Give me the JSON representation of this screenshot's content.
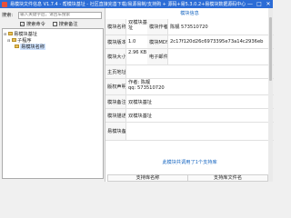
{
  "window": {
    "title": "易模块文件信息 V1.7.4 - 帮模块基址 - 社区直接完善下载/易源易制/支持购 + 源码+易5.3.0.2+易模块数据源码中心",
    "controls": [
      "—",
      "□",
      "✕"
    ]
  },
  "search": {
    "label": "搜索:",
    "placeholder": "输入关键字后，请回车搜索"
  },
  "filters": [
    {
      "label": "搜索命令",
      "checked": true
    },
    {
      "label": "搜索备注",
      "checked": false
    }
  ],
  "tree": {
    "root": "易模块基址",
    "child": "子程序",
    "leaf": "易模块名称"
  },
  "info": {
    "section_title": "模块信息",
    "rows": [
      {
        "key": "模块名称",
        "value": "双模块基址",
        "key2": "模块作者",
        "value2": "陈靓 573510720"
      },
      {
        "key": "模块版本",
        "value": "1.0",
        "key2": "模块MD5",
        "value2": "2c17f120d26c6973395e73a14c2936eb"
      },
      {
        "key": "模块大小",
        "value": "2.96 KB",
        "key2": "电子邮件",
        "value2": ""
      },
      {
        "key": "主页地址",
        "value": ""
      },
      {
        "key": "版权声明",
        "value": "作者: 陈靓\nqq: 573510720"
      },
      {
        "key": "模块备注",
        "value": "双模块基址"
      },
      {
        "key": "模块描述",
        "value": "双模块基址"
      },
      {
        "key": "易模块备注",
        "value": ""
      }
    ]
  },
  "support": {
    "section_title": "此模块共调用了1个支持库",
    "columns": [
      "支持库名称",
      "支持库文件名"
    ]
  },
  "colors": {
    "titlebar": "#2b6cd6",
    "section_title": "#1565c0"
  }
}
